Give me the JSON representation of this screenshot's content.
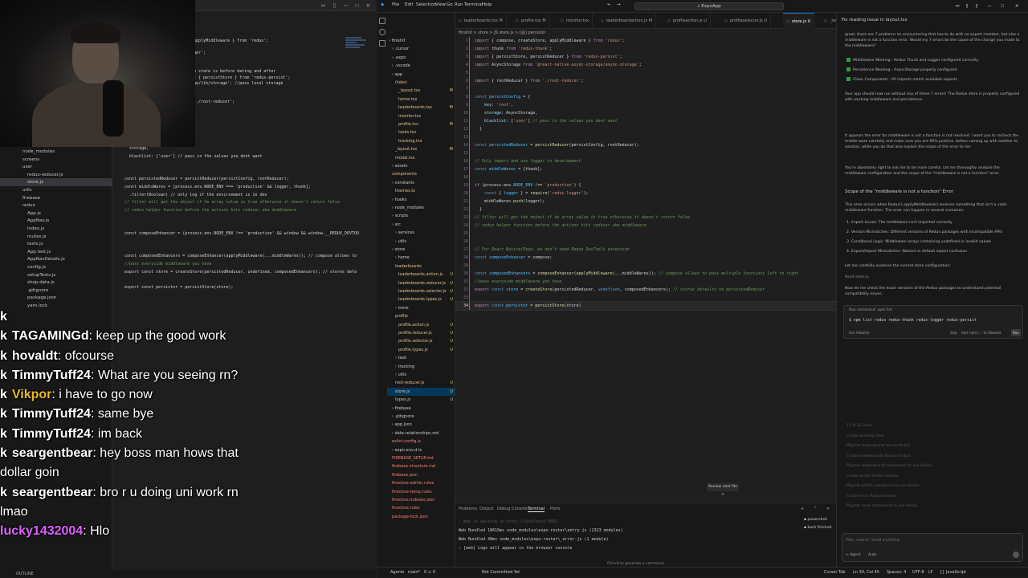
{
  "left_pane": {
    "tree": [
      "node_modules",
      "screens",
      "user",
      "redux-reducer.js",
      "store.js",
      "utils",
      "firebase",
      "redux",
      "App.js",
      "AppNav.js",
      "index.js",
      "routes.js",
      "tests.js",
      "App.test.js",
      "AppNavDetails.js",
      "config.js",
      "setupTests.js",
      "shop-data.js",
      ".gitignore",
      "package.json",
      "yarn.lock"
    ],
    "code": [
      {
        "t": "applyMiddleware } from 'redux';",
        "c": ""
      },
      {
        "t": "",
        "c": ""
      },
      {
        "t": "ger';",
        "c": ""
      },
      {
        "t": "",
        "c": ""
      },
      {
        "t": "",
        "c": ""
      },
      {
        "t": "m state is before dating and after",
        "c": "cm"
      },
      {
        "t": "t { persistStore } from 'redux-persist';",
        "c": ""
      },
      {
        "t": "ge/lib/storage'; //pass local storage",
        "c": ""
      },
      {
        "t": "",
        "c": ""
      },
      {
        "t": "",
        "c": ""
      },
      {
        "t": "'./root-reducer';",
        "c": ""
      }
    ],
    "code2": [
      {
        "t": "  storage,",
        "c": ""
      },
      {
        "t": "  blacklist: ['user'] // pass in the values you dont want",
        "c": ""
      },
      {
        "t": "",
        "c": ""
      },
      {
        "t": "",
        "c": ""
      },
      {
        "t": "const persistedReducer = persistReducer(persistConfig, rootReducer);",
        "c": ""
      },
      {
        "t": "const middleWares = [process.env.NODE_ENV === 'production' && logger, thunk];",
        "c": ""
      },
      {
        "t": "  .filter(Boolean) // only log if the environment is in dev",
        "c": ""
      },
      {
        "t": "// filter will get the object if he array value is true otherwise it doesn't return false",
        "c": "cm"
      },
      {
        "t": "// redux helper function before the actions hits reducer aka middleware",
        "c": "cm"
      },
      {
        "t": "",
        "c": ""
      },
      {
        "t": "",
        "c": ""
      },
      {
        "t": "const composeEnhancer = (process.env.NODE_ENV !== 'production' && window && window.__REDUX_DEVTOO",
        "c": ""
      },
      {
        "t": "",
        "c": ""
      },
      {
        "t": "",
        "c": ""
      },
      {
        "t": "const composedEnhancers = composeEnhancer(applyMiddleware(...middleWares)); // compose allows to",
        "c": ""
      },
      {
        "t": "//pass everyside middleware you have",
        "c": "cm"
      },
      {
        "t": "export const store = createStore(persistedReducer, undefined, composedEnhancers); // stores defa",
        "c": ""
      },
      {
        "t": "",
        "c": ""
      },
      {
        "t": "export const persistor = persistStore(store);",
        "c": ""
      }
    ],
    "status": "OUTLINE"
  },
  "chat": [
    {
      "badge": "k",
      "user": "",
      "msg": "",
      "color": "#ffffff"
    },
    {
      "badge": "k",
      "user": "TAGAMINGd",
      "msg": ": keep up the good work",
      "color": "#ffffff"
    },
    {
      "badge": "k",
      "user": "hovaldt",
      "msg": ": ofcourse",
      "color": "#ffffff"
    },
    {
      "badge": "k",
      "user": "TimmyTuff24",
      "msg": ": What are you seeing rn?",
      "color": "#ffffff"
    },
    {
      "badge": "k",
      "user": "Vikpor",
      "msg": ": i have to go now",
      "color": "#e8b923"
    },
    {
      "badge": "k",
      "user": "TimmyTuff24",
      "msg": ": same bye",
      "color": "#ffffff"
    },
    {
      "badge": "k",
      "user": "TimmyTuff24",
      "msg": ": im back",
      "color": "#ffffff"
    },
    {
      "badge": "k",
      "user": "seargentbear",
      "msg": ": hey boss man hows that dollar goin",
      "color": "#ffffff"
    },
    {
      "badge": "k",
      "user": "seargentbear",
      "msg": ": bro r u doing uni work rn lmao",
      "color": "#ffffff"
    },
    {
      "badge": "",
      "user": "lucky1432004",
      "msg": ": Hlo",
      "color": "#e060ff"
    }
  ],
  "ide": {
    "menu": [
      "File",
      "Edit",
      "Selection",
      "View",
      "Go",
      "Run",
      "Terminal",
      "Help"
    ],
    "search": "ExpoApp",
    "tabs": [
      {
        "label": "leaderboards.tsx M",
        "active": false
      },
      {
        "label": "profile.tsx M",
        "active": false
      },
      {
        "label": "monitor.tsx",
        "active": false
      },
      {
        "label": "leaderboardaction.js M",
        "active": false
      },
      {
        "label": "profileaction.js U",
        "active": false
      },
      {
        "label": "profileselector.js U",
        "active": false
      },
      {
        "label": "store.js U",
        "active": true
      },
      {
        "label": "_layout.tsx M",
        "active": false
      }
    ],
    "breadcrumb": "finishit > store > JS store.js > [@] persistor",
    "explorer": [
      {
        "label": "finishit",
        "indent": 0,
        "kind": "folder",
        "mark": ""
      },
      {
        "label": ".cursor",
        "indent": 1,
        "kind": "folder",
        "mark": ""
      },
      {
        "label": ".expo",
        "indent": 1,
        "kind": "folder",
        "mark": ""
      },
      {
        "label": ".vscode",
        "indent": 1,
        "kind": "folder",
        "mark": ""
      },
      {
        "label": "app",
        "indent": 1,
        "kind": "folder",
        "mark": ""
      },
      {
        "label": "(tabs)",
        "indent": 2,
        "kind": "mod",
        "mark": ""
      },
      {
        "label": "_layout.tsx",
        "indent": 3,
        "kind": "mod",
        "mark": "M"
      },
      {
        "label": "home.tsx",
        "indent": 3,
        "kind": "mod",
        "mark": ""
      },
      {
        "label": "leaderboards.tsx",
        "indent": 3,
        "kind": "mod",
        "mark": "M"
      },
      {
        "label": "monitor.tsx",
        "indent": 3,
        "kind": "mod",
        "mark": ""
      },
      {
        "label": "profile.tsx",
        "indent": 3,
        "kind": "mod",
        "mark": "M"
      },
      {
        "label": "tasks.tsx",
        "indent": 3,
        "kind": "mod",
        "mark": ""
      },
      {
        "label": "tracking.tsx",
        "indent": 3,
        "kind": "mod",
        "mark": ""
      },
      {
        "label": "_layout.tsx",
        "indent": 2,
        "kind": "mod",
        "mark": "M"
      },
      {
        "label": "modal.tsx",
        "indent": 2,
        "kind": "mod",
        "mark": ""
      },
      {
        "label": "assets",
        "indent": 1,
        "kind": "folder",
        "mark": ""
      },
      {
        "label": "components",
        "indent": 1,
        "kind": "mod",
        "mark": ""
      },
      {
        "label": "constants",
        "indent": 1,
        "kind": "folder",
        "mark": ""
      },
      {
        "label": "themes.ts",
        "indent": 2,
        "kind": "mod",
        "mark": ""
      },
      {
        "label": "hooks",
        "indent": 1,
        "kind": "folder",
        "mark": ""
      },
      {
        "label": "node_modules",
        "indent": 1,
        "kind": "folder",
        "mark": ""
      },
      {
        "label": "scripts",
        "indent": 1,
        "kind": "folder",
        "mark": ""
      },
      {
        "label": "src",
        "indent": 1,
        "kind": "folder",
        "mark": ""
      },
      {
        "label": "services",
        "indent": 2,
        "kind": "folder",
        "mark": ""
      },
      {
        "label": "utils",
        "indent": 2,
        "kind": "folder",
        "mark": ""
      },
      {
        "label": "store",
        "indent": 1,
        "kind": "folder",
        "mark": ""
      },
      {
        "label": "home",
        "indent": 2,
        "kind": "folder",
        "mark": ""
      },
      {
        "label": "leaderboards",
        "indent": 2,
        "kind": "mod",
        "mark": ""
      },
      {
        "label": "leaderboards.action.js",
        "indent": 3,
        "kind": "mod",
        "mark": "U"
      },
      {
        "label": "leaderboards.reducer.js",
        "indent": 3,
        "kind": "mod",
        "mark": "U"
      },
      {
        "label": "leaderboards.selector.js",
        "indent": 3,
        "kind": "mod",
        "mark": "U"
      },
      {
        "label": "leaderboards.types.js",
        "indent": 3,
        "kind": "mod",
        "mark": "U"
      },
      {
        "label": "more",
        "indent": 2,
        "kind": "folder",
        "mark": ""
      },
      {
        "label": "profile",
        "indent": 2,
        "kind": "mod",
        "mark": ""
      },
      {
        "label": "profile.action.js",
        "indent": 3,
        "kind": "mod",
        "mark": "U"
      },
      {
        "label": "profile.reducer.js",
        "indent": 3,
        "kind": "mod",
        "mark": "U"
      },
      {
        "label": "profile.selector.js",
        "indent": 3,
        "kind": "mod",
        "mark": "U"
      },
      {
        "label": "profile.types.js",
        "indent": 3,
        "kind": "mod",
        "mark": "U"
      },
      {
        "label": "task",
        "indent": 2,
        "kind": "folder",
        "mark": ""
      },
      {
        "label": "tracking",
        "indent": 2,
        "kind": "folder",
        "mark": ""
      },
      {
        "label": "utils",
        "indent": 2,
        "kind": "folder",
        "mark": ""
      },
      {
        "label": "root-reducer.js",
        "indent": 2,
        "kind": "mod",
        "mark": "U"
      },
      {
        "label": "store.js",
        "indent": 2,
        "kind": "sel",
        "mark": "U"
      },
      {
        "label": "types.js",
        "indent": 2,
        "kind": "mod",
        "mark": "U"
      },
      {
        "label": "firebase",
        "indent": 1,
        "kind": "folder",
        "mark": ""
      },
      {
        "label": ".gitignore",
        "indent": 1,
        "kind": "folder",
        "mark": ""
      },
      {
        "label": "app.json",
        "indent": 1,
        "kind": "folder",
        "mark": ""
      },
      {
        "label": "data-relationships.md",
        "indent": 1,
        "kind": "folder",
        "mark": ""
      },
      {
        "label": "eslint.config.js",
        "indent": 1,
        "kind": "red",
        "mark": ""
      },
      {
        "label": "expo-env.d.ts",
        "indent": 1,
        "kind": "folder",
        "mark": ""
      },
      {
        "label": "FIREBASE_SETUP.md",
        "indent": 1,
        "kind": "red",
        "mark": ""
      },
      {
        "label": "firebase-structure.md",
        "indent": 1,
        "kind": "red",
        "mark": ""
      },
      {
        "label": "firebase.json",
        "indent": 1,
        "kind": "red",
        "mark": ""
      },
      {
        "label": "firestore-admin.rules",
        "indent": 1,
        "kind": "red",
        "mark": ""
      },
      {
        "label": "firestore-temp.rules",
        "indent": 1,
        "kind": "red",
        "mark": ""
      },
      {
        "label": "firestore.indexes.json",
        "indent": 1,
        "kind": "red",
        "mark": ""
      },
      {
        "label": "firestore.rules",
        "indent": 1,
        "kind": "red",
        "mark": ""
      },
      {
        "label": "package-lock.json",
        "indent": 1,
        "kind": "red",
        "mark": ""
      }
    ],
    "code": [
      {
        "n": "1",
        "h": "<span class='k'>import</span> { compose, createStore, applyMiddleware } <span class='k'>from</span> <span class='s'>'redux'</span>;"
      },
      {
        "n": "2",
        "h": "<span class='k'>import</span> thunk <span class='k'>from</span> <span class='s'>'redux-thunk'</span>;"
      },
      {
        "n": "3",
        "h": "<span class='k'>import</span> { persistStore, persistReducer } <span class='k'>from</span> <span class='s'>'redux-persist'</span>;"
      },
      {
        "n": "4",
        "h": "<span class='k'>import</span> AsyncStorage <span class='k'>from</span> <span class='s'>'@react-native-async-storage/async-storage'</span>;"
      },
      {
        "n": "5",
        "h": ""
      },
      {
        "n": "6",
        "h": "<span class='k'>import</span> { rootReducer } <span class='k'>from</span> <span class='s'>'./root-reducer'</span>;"
      },
      {
        "n": "7",
        "h": ""
      },
      {
        "n": "8",
        "h": "<span class='kb'>const</span> <span class='cn'>persistConfig</span> = {"
      },
      {
        "n": "9",
        "h": "    <span class='v'>key</span>: <span class='s'>'root'</span>,"
      },
      {
        "n": "10",
        "h": "    <span class='v'>storage</span>: AsyncStorage,"
      },
      {
        "n": "11",
        "h": "    <span class='v'>blacklist</span>: [<span class='s'>'user'</span>] <span class='c'>// pass in the values you dont want</span>"
      },
      {
        "n": "12",
        "h": "  }"
      },
      {
        "n": "13",
        "h": ""
      },
      {
        "n": "14",
        "h": "<span class='kb'>const</span> <span class='cn'>persistedReducer</span> = <span class='f'>persistReducer</span>(persistConfig, rootReducer);"
      },
      {
        "n": "15",
        "h": ""
      },
      {
        "n": "16",
        "h": "<span class='c'>// Only import and use logger in development</span>"
      },
      {
        "n": "17",
        "h": "<span class='kb'>const</span> <span class='cn'>middleWares</span> = [thunk];"
      },
      {
        "n": "18",
        "h": ""
      },
      {
        "n": "19",
        "h": "<span class='k'>if</span> (process.env.<span class='cn'>NODE_ENV</span> !== <span class='s'>'production'</span>) {"
      },
      {
        "n": "20",
        "h": "    <span class='kb'>const</span> { <span class='cn'>logger</span> } = <span class='f'>require</span>(<span class='s'>'redux-logger'</span>);"
      },
      {
        "n": "21",
        "h": "    middleWares.<span class='f'>push</span>(logger);"
      },
      {
        "n": "22",
        "h": "  }"
      },
      {
        "n": "23",
        "h": "<span class='c'>// filter will get the object if he array value is true otherwise it doesn't return false</span>"
      },
      {
        "n": "24",
        "h": "<span class='c'>// redux helper function before the actions hits reducer aka middleware</span>"
      },
      {
        "n": "25",
        "h": ""
      },
      {
        "n": "26",
        "h": ""
      },
      {
        "n": "27",
        "h": "<span class='c'>// For React Native/Expo, we don't need Redux DevTools extension</span>"
      },
      {
        "n": "28",
        "h": "<span class='kb'>const</span> <span class='cn'>composeEnhancer</span> = compose;"
      },
      {
        "n": "29",
        "h": ""
      },
      {
        "n": "30",
        "h": "<span class='kb'>const</span> <span class='cn'>composedEnhancers</span> = <span class='f'>composeEnhancer</span>(<span class='f'>applyMiddleware</span>(...middleWares)); <span class='c'>// compose allows to pass multiple functions left to right</span>"
      },
      {
        "n": "31",
        "h": "<span class='c'>//pass everyside middleware you have</span>"
      },
      {
        "n": "32",
        "h": "<span class='k'>export</span> <span class='kb'>const</span> <span class='cn'>store</span> = <span class='f'>createStore</span>(persistedReducer, <span class='kb'>undefined</span>, composedEnhancers); <span class='c'>// stores defaults to persistedReducer</span>"
      },
      {
        "n": "33",
        "h": ""
      },
      {
        "n": "34",
        "h": "<span class='k'>export</span> <span class='kb'>const</span> <span class='cn'>persistor</span> = <span class='f'>persistStore</span>(store)"
      }
    ],
    "review_label": "Review next file >",
    "panel_tabs": [
      "Problems",
      "Output",
      "Debug Console",
      "Terminal",
      "Ports"
    ],
    "terminal_lines": [
      "› Web is waiting on http://localhost:8081",
      "Web Bundled 18616ms node_modules\\expo-router\\entry.js (2323 modules)",
      "Web Bundled 48ms node_modules\\expo-router\\_error.js (1 module)",
      "› [web] Logs will appear in the browser console"
    ],
    "term_list": [
      "powershell",
      "bash finished"
    ],
    "hint": "Ctrl+K to generate a command",
    "status_left": [
      "Agents",
      "main*",
      "0 ⚠ 0",
      "Not Committed Yet"
    ],
    "status_right": [
      "Cursor Tab",
      "Ln 34, Col 45",
      "Spaces: 4",
      "UTF-8",
      "LF",
      "{} JavaScript"
    ]
  },
  "agent": {
    "title": "Fix reading issue in layout.tsx",
    "intro": "great, there are 7 problems im encountering that has to do with no expert member, but also a middleware is not a function error. Would my 7 errors be the cause of the change you made to the middleware?",
    "checks": [
      "Middleware Working - Redux Thunk and Logger configured correctly",
      "Persistence Working - AsyncStorage properly configured",
      "Clean Components - All imports match available exports"
    ],
    "p1": "Your app should now run without any of these 7 errors! The Redux store is properly configured with working middleware and persistence.",
    "p2": "It appears the error for middleware is not a function is not resolved. I want you to recheck the middle ware carefully and make sure you are 90% positive, before coming up with another to solution, while you do that also explain the scope of the error to me",
    "p3": "You're absolutely right to ask me to be more careful. Let me thoroughly analyze the middleware configuration and the scope of the \"middleware is not a function\" error.",
    "heading": "Scope of the \"middleware is not a function\" Error",
    "p4": "This error occurs when Redux's applyMiddleware() receives something that isn't a valid middleware function. The error can happen in several scenarios:",
    "list": [
      "1. Import Issues: The middleware isn't imported correctly",
      "2. Version Mismatches: Different versions of Redux packages with incompatible APIs",
      "3. Conditional Logic: Middleware arrays containing undefined or invalid values",
      "4. Export/Import Mismatches: Named vs default export confusion"
    ],
    "p5": "Let me carefully examine the current store configuration:",
    "p6": "Read store.js",
    "p7": "Now let me check the exact versions of the Redux packages to understand potential compatibility issues:",
    "run_label": "Run command: npm list",
    "run_cmd": "$ npm list redux redux-thunk redux-logger redux-persist",
    "run_actions": [
      "Use Allowlist",
      "Skip",
      "Add 'npm l...' to Allowlist",
      "Run"
    ],
    "faded": [
      "12 of 12 Done",
      "Create working store",
      "Migrate leaderboards to use Redux",
      "Create leaderboards Redux module",
      "Migrate leaderboards component to use Redux",
      "Create profile Redux module",
      "Migrate profile component to use Redux",
      "Create more Redux module",
      "Migrate more component to use Redux"
    ],
    "followup_ph": "Plan, search, build anything",
    "agent_label": "Agent",
    "model": "Auto"
  }
}
